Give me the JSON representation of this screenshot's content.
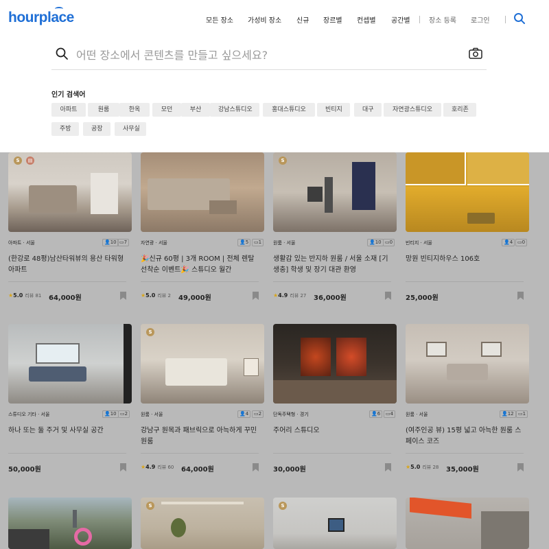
{
  "header": {
    "logo": "hourplace",
    "nav": [
      "모든 장소",
      "가성비 장소",
      "신규",
      "장르별",
      "컨셉별",
      "공간별"
    ],
    "register_label": "장소 등록",
    "login_label": "로그인"
  },
  "search": {
    "placeholder": "어떤 장소에서 콘텐츠를 만들고 싶으세요?"
  },
  "popular": {
    "title": "인기 검색어",
    "tags": [
      "아파트",
      "원룸",
      "한옥",
      "모던",
      "부산",
      "강남스튜디오",
      "홍대스튜디오",
      "빈티지",
      "대구",
      "자연광스튜디오",
      "호리존",
      "주방",
      "공장",
      "사무실"
    ]
  },
  "listings": [
    {
      "category": "아파트 · 서울",
      "people": "10",
      "parking": "7",
      "title": "(한강로 48평)남산타워뷰의 용산 타워형 아파트",
      "rating": "5.0",
      "reviews": "리뷰 81",
      "price": "64,000원"
    },
    {
      "category": "자연광 · 서울",
      "people": "5",
      "parking": "1",
      "title": "🎉신규 60평 | 3개 ROOM | 전체 렌탈 선착순 이벤트🎉 스튜디오 월간",
      "rating": "5.0",
      "reviews": "리뷰 2",
      "price": "49,000원"
    },
    {
      "category": "원룸 · 서울",
      "people": "10",
      "parking": "0",
      "title": "생활감 있는 반지하 원룸 / 서울 소재 [기생충] 학생 및 장기 대관 환영",
      "rating": "4.9",
      "reviews": "리뷰 27",
      "price": "36,000원"
    },
    {
      "category": "빈티지 · 서울",
      "people": "4",
      "parking": "0",
      "title": "망원 빈티지하우스 106호",
      "rating": "",
      "reviews": "",
      "price": "25,000원"
    },
    {
      "category": "스튜디오 기타 · 서울",
      "people": "10",
      "parking": "2",
      "title": "하나 또는 둘 주거 및 사무실 공간",
      "rating": "",
      "reviews": "",
      "price": "50,000원"
    },
    {
      "category": "원룸 · 서울",
      "people": "4",
      "parking": "2",
      "title": "강남구 원목과 패브릭으로 아늑하게 꾸민 원룸",
      "rating": "4.9",
      "reviews": "리뷰 60",
      "price": "64,000원"
    },
    {
      "category": "단독주택형 · 경기",
      "people": "6",
      "parking": "4",
      "title": "주어리 스튜디오",
      "rating": "",
      "reviews": "",
      "price": "30,000원"
    },
    {
      "category": "원룸 · 서울",
      "people": "12",
      "parking": "1",
      "title": "(여주인공 뷰) 15평 넓고 아늑한 원룸 스페이스 코즈",
      "rating": "5.0",
      "reviews": "리뷰 28",
      "price": "35,000원"
    }
  ]
}
